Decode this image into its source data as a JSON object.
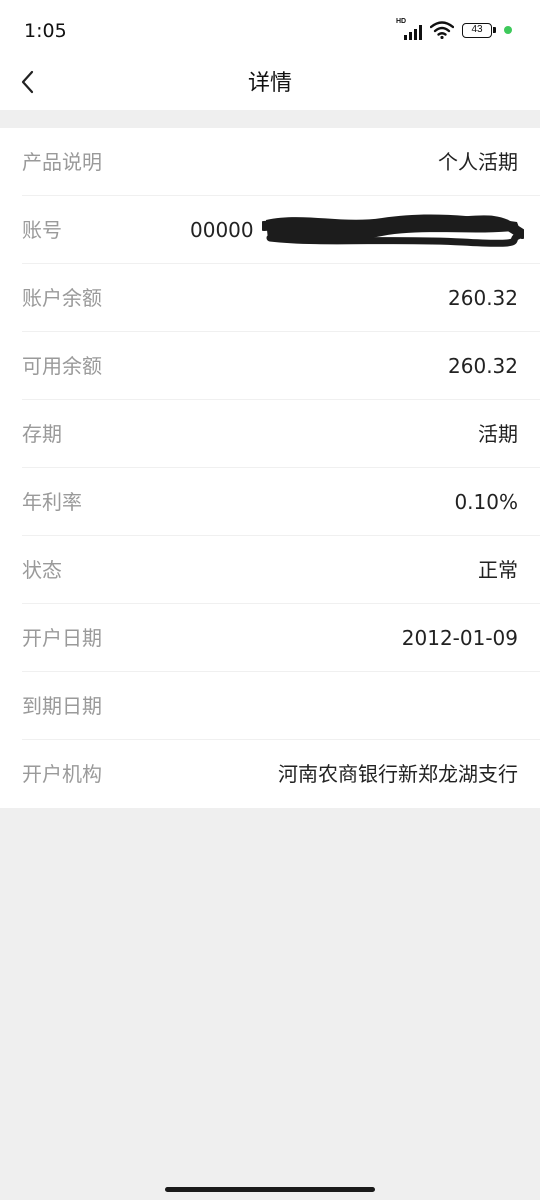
{
  "status_bar": {
    "time": "1:05",
    "network_label": "HD",
    "battery": "43",
    "signal_icon": "signal-icon",
    "wifi_icon": "wifi-icon",
    "battery_icon": "battery-icon",
    "indicator_color": "#3ec95b"
  },
  "header": {
    "title": "详情",
    "back_icon": "chevron-left-icon"
  },
  "details": [
    {
      "label": "产品说明",
      "value": "个人活期"
    },
    {
      "label": "账号",
      "value": "00000"
    },
    {
      "label": "账户余额",
      "value": "260.32"
    },
    {
      "label": "可用余额",
      "value": "260.32"
    },
    {
      "label": "存期",
      "value": "活期"
    },
    {
      "label": "年利率",
      "value": "0.10%"
    },
    {
      "label": "状态",
      "value": "正常"
    },
    {
      "label": "开户日期",
      "value": "2012-01-09"
    },
    {
      "label": "到期日期",
      "value": ""
    },
    {
      "label": "开户机构",
      "value": "河南农商银行新郑龙湖支行"
    }
  ],
  "colors": {
    "background": "#efefef",
    "card": "#ffffff",
    "label": "#9a9a9a",
    "value": "#222222"
  }
}
